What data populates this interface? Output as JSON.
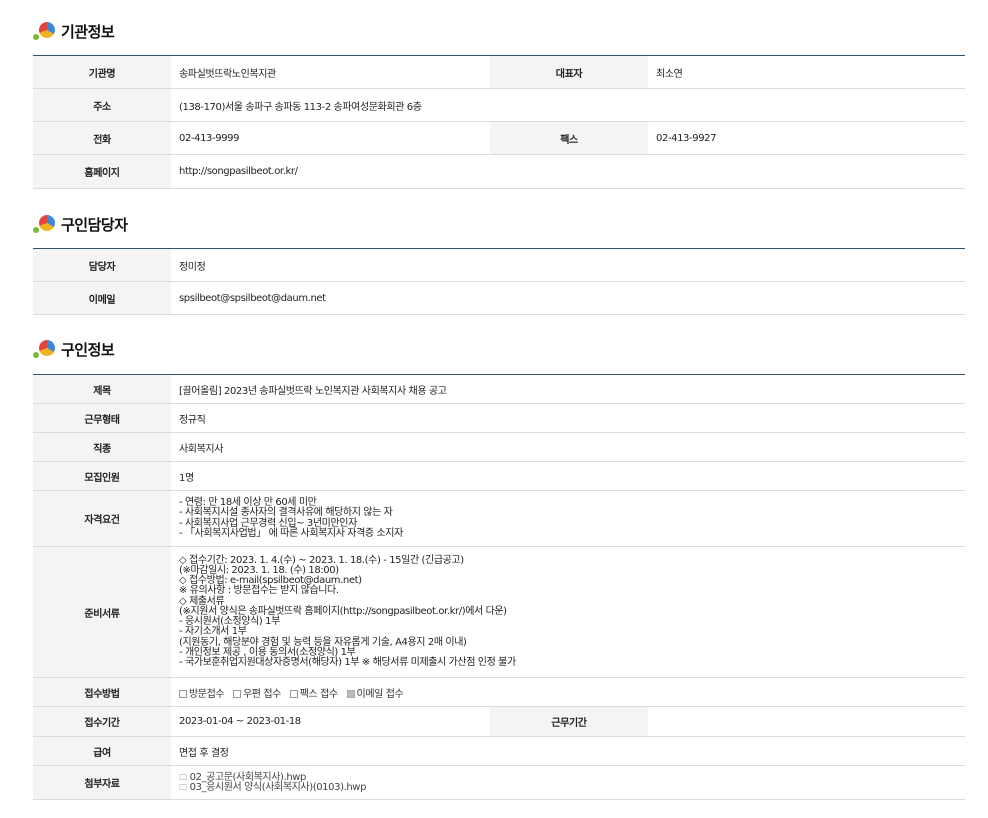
{
  "org_section": {
    "title": "기관정보",
    "name_label": "기관명",
    "name": "송파실벗뜨락노인복지관",
    "rep_label": "대표자",
    "rep": "최소연",
    "addr_label": "주소",
    "addr": "(138-170)서울 송파구 송파동 113-2 송파여성문화회관 6층",
    "tel_label": "전화",
    "tel": "02-413-9999",
    "fax_label": "팩스",
    "fax": "02-413-9927",
    "home_label": "홈페이지",
    "home": "http://songpasilbeot.or.kr/"
  },
  "contact_section": {
    "title": "구인담당자",
    "person_label": "담당자",
    "person": "정미정",
    "email_label": "이메일",
    "email": "spsilbeot@spsilbeot@daum.net"
  },
  "job_section": {
    "title": "구인정보",
    "subject_label": "제목",
    "subject": "[끌어올림] 2023년 송파실벗뜨락 노인복지관 사회복지사 채용 공고",
    "type_label": "근무형태",
    "type": "정규직",
    "job_label": "직종",
    "job": "사회복지사",
    "count_label": "모집인원",
    "count": "1명",
    "qual_label": "자격요건",
    "qual_lines": [
      "- 연령: 만 18세 이상 만 60세 미만",
      "- 사회복지시설 종사자의 결격사유에 해당하지 않는 자",
      "- 사회복지사업 근무경력 신입~ 3년미만인자",
      "- 「사회복지사업법」 에 따른 사회복지사 자격증 소지자"
    ],
    "docs_label": "준비서류",
    "docs_lines": [
      "◇ 접수기간: 2023. 1. 4.(수) ~ 2023. 1. 18.(수) - 15일간 (긴급공고)",
      "(※마감일시: 2023. 1. 18. (수) 18:00)",
      "◇ 접수방법: e-mail(spsilbeot@daum.net)",
      "※ 유의사항 : 방문접수는 받지 않습니다.",
      "◇ 제출서류",
      "(※지원서 양식은 송파실벗뜨락 홈페이지(http://songpasilbeot.or.kr/)에서 다운)",
      "- 응시원서(소정양식) 1부",
      "- 자기소개서 1부",
      "(지원동기, 해당분야 경험 및 능력 등을 자유롭게 기술, A4용지 2매 이내)",
      "- 개인정보 제공 , 이용 동의서(소정양식) 1부",
      "- 국가보훈취업지원대상자증명서(해당자) 1부 ※ 해당서류 미제출시 가산점 인정 불가"
    ],
    "method_label": "접수방법",
    "methods": [
      {
        "label": "방문접수",
        "checked": false
      },
      {
        "label": "우편 접수",
        "checked": false
      },
      {
        "label": "팩스 접수",
        "checked": false
      },
      {
        "label": "이메일 접수",
        "checked": true
      }
    ],
    "period_label": "접수기간",
    "period": "2023-01-04 ~ 2023-01-18",
    "work_period_label": "근무기간",
    "work_period": "",
    "salary_label": "급여",
    "salary": "면접 후 결정",
    "attach_label": "첨부자료",
    "attachments": [
      "02_공고문(사회복지사).hwp",
      "03_응시원서 양식(사회복지사)(0103).hwp"
    ]
  }
}
